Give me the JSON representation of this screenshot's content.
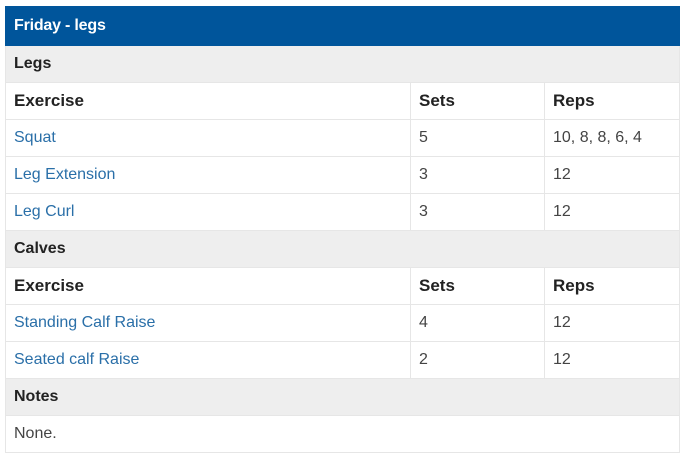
{
  "title": "Friday - legs",
  "headers": {
    "exercise": "Exercise",
    "sets": "Sets",
    "reps": "Reps"
  },
  "sections": [
    {
      "name": "Legs",
      "rows": [
        {
          "exercise": "Squat",
          "sets": "5",
          "reps": "10, 8, 8, 6, 4"
        },
        {
          "exercise": "Leg Extension",
          "sets": "3",
          "reps": "12"
        },
        {
          "exercise": "Leg Curl",
          "sets": "3",
          "reps": "12"
        }
      ]
    },
    {
      "name": "Calves",
      "rows": [
        {
          "exercise": "Standing Calf Raise",
          "sets": "4",
          "reps": "12"
        },
        {
          "exercise": "Seated calf Raise",
          "sets": "2",
          "reps": "12"
        }
      ]
    }
  ],
  "notes": {
    "label": "Notes",
    "text": "None."
  },
  "colors": {
    "header_bg": "#00559b",
    "section_bg": "#eeeeee",
    "link": "#2a6fa8"
  }
}
